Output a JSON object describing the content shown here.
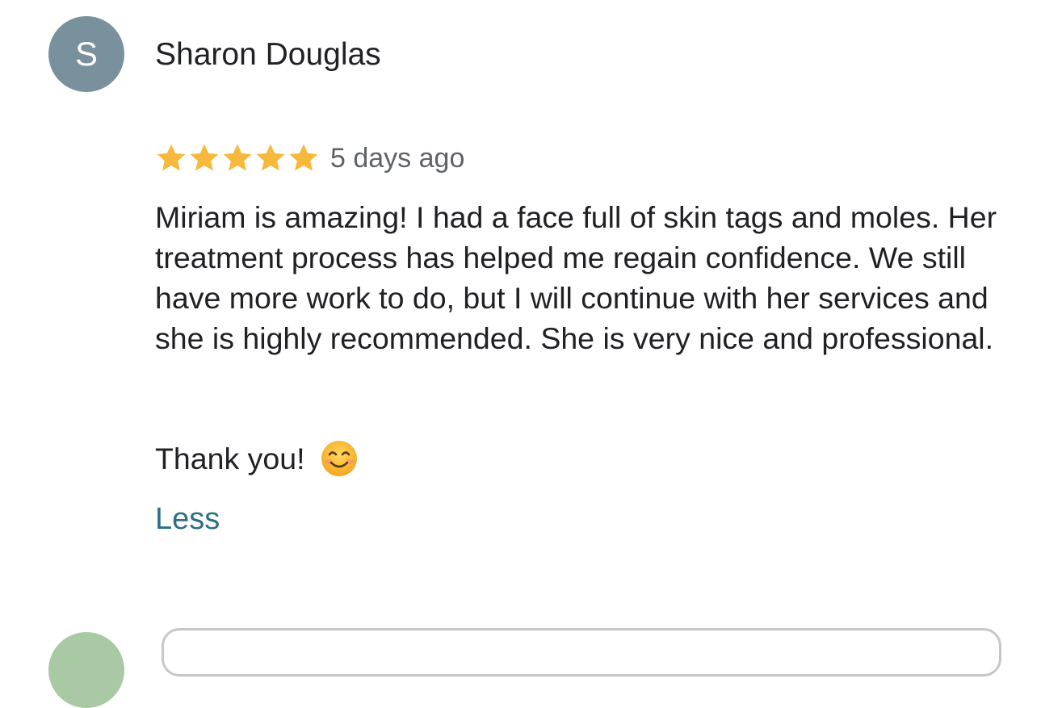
{
  "review": {
    "avatar_initial": "S",
    "reviewer_name": "Sharon Douglas",
    "rating": 5,
    "rating_max": 5,
    "date": "5 days ago",
    "body": "Miriam is amazing! I had a face full of skin tags and moles. Her treatment process has helped me regain confidence. We still have more work to do, but I will continue with her services and she is highly recommended. She is very nice and professional.",
    "thanks": "Thank you!",
    "less_label": "Less"
  },
  "icons": {
    "star": "star-icon",
    "emoji": "smiling-face-icon"
  },
  "colors": {
    "avatar_bg": "#79909d",
    "star": "#f6b93b",
    "link": "#2c6f86",
    "muted_text": "#5f6368",
    "next_avatar_bg": "#a9c8a4"
  }
}
